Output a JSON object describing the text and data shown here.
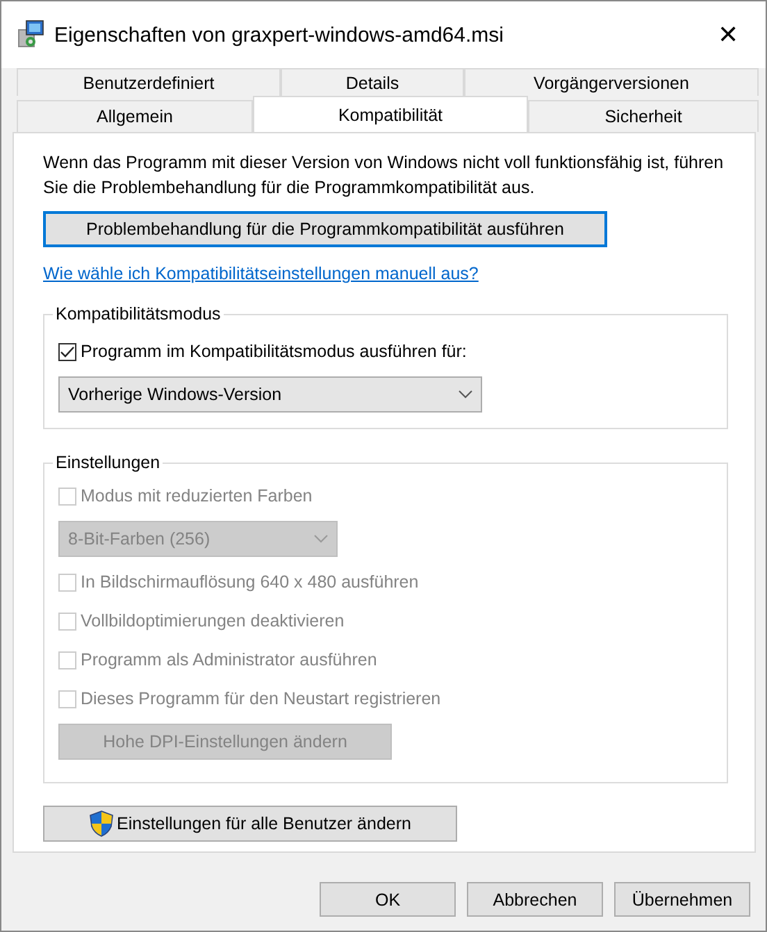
{
  "window": {
    "title": "Eigenschaften von graxpert-windows-amd64.msi",
    "close": "✕"
  },
  "tab_rows": [
    {
      "tabs": [
        {
          "label": "Benutzerdefiniert",
          "selected": false
        },
        {
          "label": "Details",
          "selected": false
        },
        {
          "label": "Vorgängerversionen",
          "selected": false
        }
      ]
    },
    {
      "tabs": [
        {
          "label": "Allgemein",
          "selected": false
        },
        {
          "label": "Kompatibilität",
          "selected": true
        },
        {
          "label": "Sicherheit",
          "selected": false
        }
      ]
    }
  ],
  "intro": "Wenn das Programm mit dieser Version von Windows nicht voll funktionsfähig ist, führen Sie die Problembehandlung für die Programmkompatibilität aus.",
  "troubleshoot_button": "Problembehandlung für die Programmkompatibilität ausführen",
  "help_link": "Wie wähle ich Kompatibilitätseinstellungen manuell aus?",
  "groups": [
    {
      "title": "Kompatibilitätsmodus",
      "items": [
        {
          "kind": "checkbox",
          "label": "Programm im Kompatibilitätsmodus ausführen für:",
          "checked": true,
          "disabled": false
        },
        {
          "kind": "dropdown",
          "value": "Vorherige Windows-Version",
          "disabled": false
        }
      ]
    },
    {
      "title": "Einstellungen",
      "items": [
        {
          "kind": "checkbox",
          "label": "Modus mit reduzierten Farben",
          "checked": false,
          "disabled": true
        },
        {
          "kind": "dropdown",
          "value": "8-Bit-Farben (256)",
          "disabled": true
        },
        {
          "kind": "checkbox",
          "label": "In Bildschirmauflösung 640 x 480 ausführen",
          "checked": false,
          "disabled": true
        },
        {
          "kind": "checkbox",
          "label": "Vollbildoptimierungen deaktivieren",
          "checked": false,
          "disabled": true
        },
        {
          "kind": "checkbox",
          "label": "Programm als Administrator ausführen",
          "checked": false,
          "disabled": true
        },
        {
          "kind": "checkbox",
          "label": "Dieses Programm für den Neustart registrieren",
          "checked": false,
          "disabled": true
        },
        {
          "kind": "button",
          "label": "Hohe DPI-Einstellungen ändern",
          "disabled": true
        }
      ]
    }
  ],
  "all_users_button": "Einstellungen für alle Benutzer ändern",
  "buttons": [
    "OK",
    "Abbrechen",
    "Übernehmen"
  ]
}
